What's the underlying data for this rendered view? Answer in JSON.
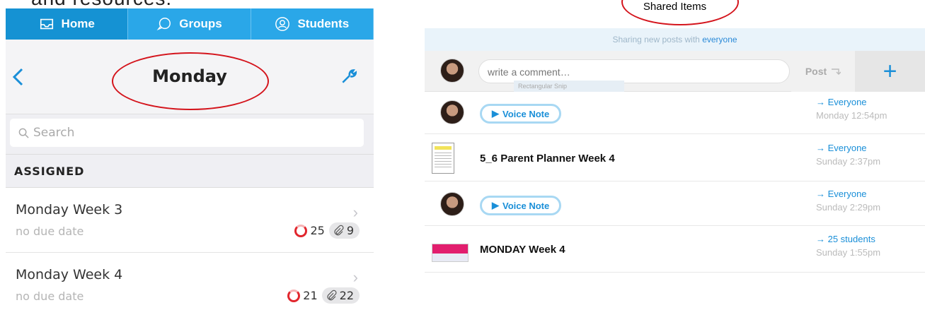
{
  "left": {
    "cut_text": "and resources.",
    "tabs": [
      {
        "label": "Home",
        "icon": "inbox-icon"
      },
      {
        "label": "Groups",
        "icon": "chat-bubbles-icon"
      },
      {
        "label": "Students",
        "icon": "student-icon"
      }
    ],
    "nav": {
      "title": "Monday"
    },
    "search": {
      "placeholder": "Search"
    },
    "section_header": "ASSIGNED",
    "assignments": [
      {
        "title": "Monday Week 3",
        "due": "no due date",
        "count": "25",
        "attachments": "9"
      },
      {
        "title": "Monday Week 4",
        "due": "no due date",
        "count": "21",
        "attachments": "22"
      }
    ]
  },
  "right": {
    "header_title": "Shared Items",
    "sharing_bar": {
      "prefix": "Sharing new posts with",
      "audience": "everyone"
    },
    "composer": {
      "placeholder": "write a comment…",
      "post_label": "Post",
      "add_label": "+"
    },
    "snip_hint": "Rectangular Snip",
    "feed": [
      {
        "type": "voice",
        "label": "Voice Note",
        "to": "→ Everyone",
        "time": "Monday 12:54pm"
      },
      {
        "type": "doc",
        "label": "5_6 Parent Planner Week 4",
        "to": "→ Everyone",
        "time": "Sunday 2:37pm"
      },
      {
        "type": "voice",
        "label": "Voice Note",
        "to": "→ Everyone",
        "time": "Sunday 2:29pm"
      },
      {
        "type": "slide",
        "label": "MONDAY Week 4",
        "to": "→ 25 students",
        "time": "Sunday 1:55pm"
      }
    ]
  },
  "colors": {
    "accent": "#1a8fd8",
    "tabbar": "#2aa7e8",
    "annotation": "#d4141c",
    "progress": "#e1262d",
    "slide_thumb": "#e21e6e"
  }
}
